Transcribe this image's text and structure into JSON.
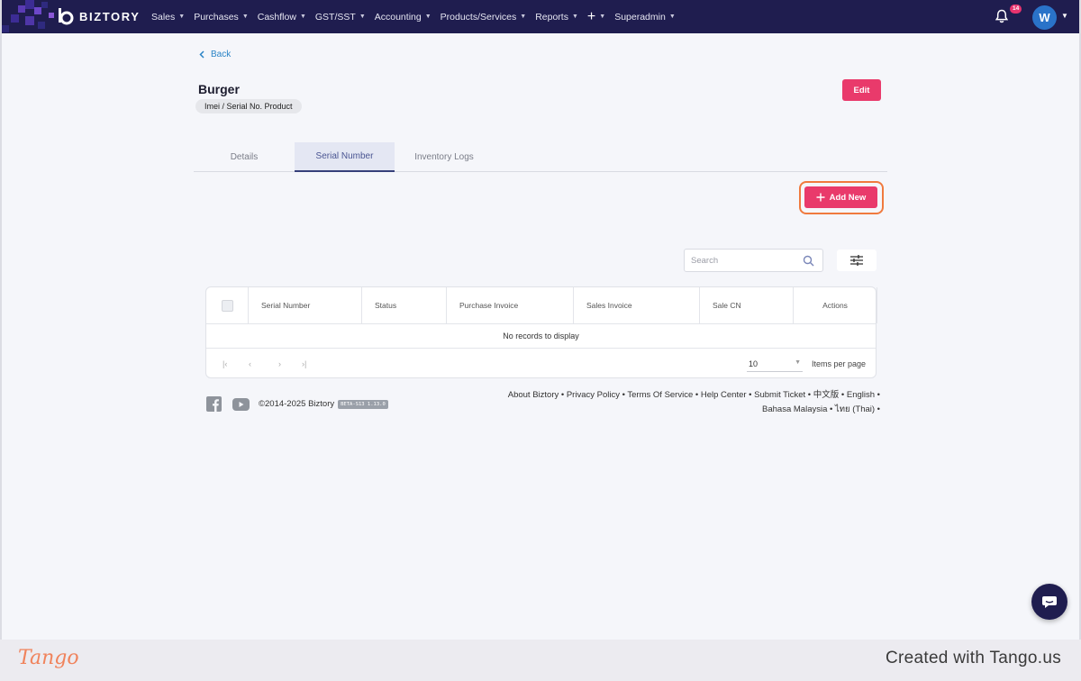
{
  "nav": {
    "brand": "BIZTORY",
    "menu": [
      {
        "label": "Sales"
      },
      {
        "label": "Purchases"
      },
      {
        "label": "Cashflow"
      },
      {
        "label": "GST/SST"
      },
      {
        "label": "Accounting"
      },
      {
        "label": "Products/Services"
      },
      {
        "label": "Reports"
      },
      {
        "label": "+"
      },
      {
        "label": "Superadmin"
      }
    ],
    "notification_count": "14",
    "avatar_initial": "W"
  },
  "page": {
    "back_label": "Back",
    "title": "Burger",
    "product_type": "Imei / Serial No. Product",
    "edit_label": "Edit"
  },
  "tabs": [
    {
      "label": "Details",
      "active": false
    },
    {
      "label": "Serial Number",
      "active": true
    },
    {
      "label": "Inventory Logs",
      "active": false
    }
  ],
  "toolbar": {
    "add_new_label": "Add New",
    "search_placeholder": "Search"
  },
  "grid": {
    "columns": [
      "Serial Number",
      "Status",
      "Purchase Invoice",
      "Sales Invoice",
      "Sale CN",
      "Actions"
    ],
    "empty_message": "No records to display",
    "page_size": "10",
    "items_per_page_label": "Items per page"
  },
  "footer": {
    "copyright": "©2014-2025 Biztory",
    "version": "BETA-S13 1.13.0",
    "links_line1": "About Biztory • Privacy Policy • Terms Of Service • Help Center • Submit Ticket • 中文版 • English •",
    "links_line2": "Bahasa Malaysia • ไทย (Thai) •"
  },
  "tango": {
    "logo": "Tango",
    "credit": "Created with Tango.us"
  },
  "colors": {
    "navbar": "#1f1d4f",
    "accent": "#e93a6b",
    "highlight": "#f07a3e",
    "link": "#2a84c6"
  }
}
